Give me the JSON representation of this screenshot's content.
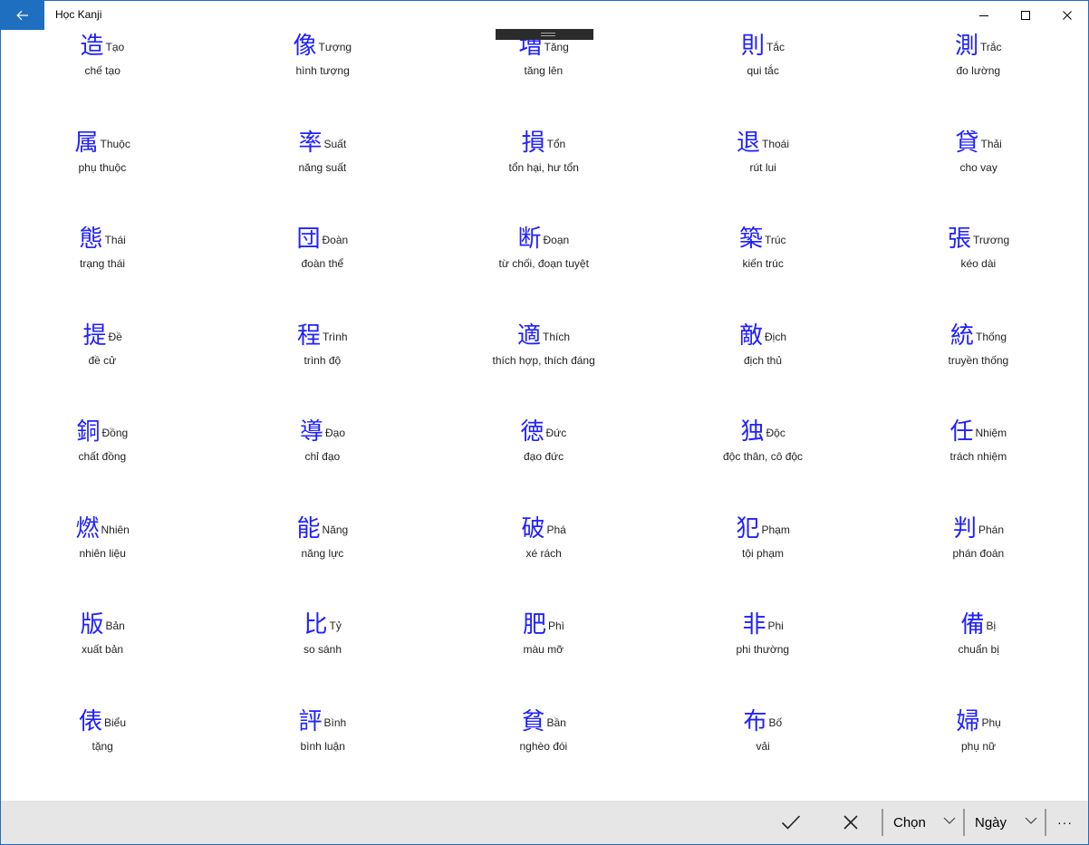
{
  "window": {
    "title": "Học Kanji"
  },
  "kanji": [
    {
      "kanji": "造",
      "reading": "Tạo",
      "meaning": "chế tạo"
    },
    {
      "kanji": "像",
      "reading": "Tượng",
      "meaning": "hình tượng"
    },
    {
      "kanji": "増",
      "reading": "Tăng",
      "meaning": "tăng lên"
    },
    {
      "kanji": "則",
      "reading": "Tắc",
      "meaning": "qui tắc"
    },
    {
      "kanji": "測",
      "reading": "Trắc",
      "meaning": "đo lường"
    },
    {
      "kanji": "属",
      "reading": "Thuộc",
      "meaning": "phụ thuộc"
    },
    {
      "kanji": "率",
      "reading": "Suất",
      "meaning": "năng suất"
    },
    {
      "kanji": "損",
      "reading": "Tổn",
      "meaning": "tổn hại, hư tổn"
    },
    {
      "kanji": "退",
      "reading": "Thoái",
      "meaning": "rút lui"
    },
    {
      "kanji": "貸",
      "reading": "Thải",
      "meaning": "cho vay"
    },
    {
      "kanji": "態",
      "reading": "Thái",
      "meaning": "trạng thái"
    },
    {
      "kanji": "団",
      "reading": "Đoàn",
      "meaning": "đoàn thể"
    },
    {
      "kanji": "断",
      "reading": "Đoạn",
      "meaning": "từ chối, đoạn tuyệt"
    },
    {
      "kanji": "築",
      "reading": "Trúc",
      "meaning": "kiến trúc"
    },
    {
      "kanji": "張",
      "reading": "Trương",
      "meaning": "kéo dài"
    },
    {
      "kanji": "提",
      "reading": "Đề",
      "meaning": "đề cử"
    },
    {
      "kanji": "程",
      "reading": "Trình",
      "meaning": "trình độ"
    },
    {
      "kanji": "適",
      "reading": "Thích",
      "meaning": "thích hợp, thích đáng"
    },
    {
      "kanji": "敵",
      "reading": "Địch",
      "meaning": "địch thủ"
    },
    {
      "kanji": "統",
      "reading": "Thống",
      "meaning": "truyền thống"
    },
    {
      "kanji": "銅",
      "reading": "Đồng",
      "meaning": "chất đồng"
    },
    {
      "kanji": "導",
      "reading": "Đạo",
      "meaning": "chỉ đạo"
    },
    {
      "kanji": "徳",
      "reading": "Đức",
      "meaning": "đạo đức"
    },
    {
      "kanji": "独",
      "reading": "Độc",
      "meaning": "độc thân, cô độc"
    },
    {
      "kanji": "任",
      "reading": "Nhiệm",
      "meaning": "trách nhiệm"
    },
    {
      "kanji": "燃",
      "reading": "Nhiên",
      "meaning": "nhiên liệu"
    },
    {
      "kanji": "能",
      "reading": "Năng",
      "meaning": "năng lực"
    },
    {
      "kanji": "破",
      "reading": "Phá",
      "meaning": "xé rách"
    },
    {
      "kanji": "犯",
      "reading": "Phạm",
      "meaning": "tội phạm"
    },
    {
      "kanji": "判",
      "reading": "Phán",
      "meaning": "phán đoán"
    },
    {
      "kanji": "版",
      "reading": "Bản",
      "meaning": "xuất bản"
    },
    {
      "kanji": "比",
      "reading": "Tỷ",
      "meaning": "so sánh"
    },
    {
      "kanji": "肥",
      "reading": "Phì",
      "meaning": "màu mỡ"
    },
    {
      "kanji": "非",
      "reading": "Phi",
      "meaning": "phi thường"
    },
    {
      "kanji": "備",
      "reading": "Bị",
      "meaning": "chuẩn bị"
    },
    {
      "kanji": "俵",
      "reading": "Biểu",
      "meaning": "tặng"
    },
    {
      "kanji": "評",
      "reading": "Bình",
      "meaning": "bình luận"
    },
    {
      "kanji": "貧",
      "reading": "Bần",
      "meaning": "nghèo đói"
    },
    {
      "kanji": "布",
      "reading": "Bố",
      "meaning": "vải"
    },
    {
      "kanji": "婦",
      "reading": "Phụ",
      "meaning": "phụ nữ"
    }
  ],
  "commandbar": {
    "accept_icon": "checkmark-icon",
    "cancel_icon": "close-icon",
    "select_label": "Chọn",
    "date_label": "Ngày",
    "more_label": "···"
  },
  "colors": {
    "accent": "#1e6fc0",
    "kanji": "#2020ff",
    "cmdbar": "#e6e6e6"
  }
}
